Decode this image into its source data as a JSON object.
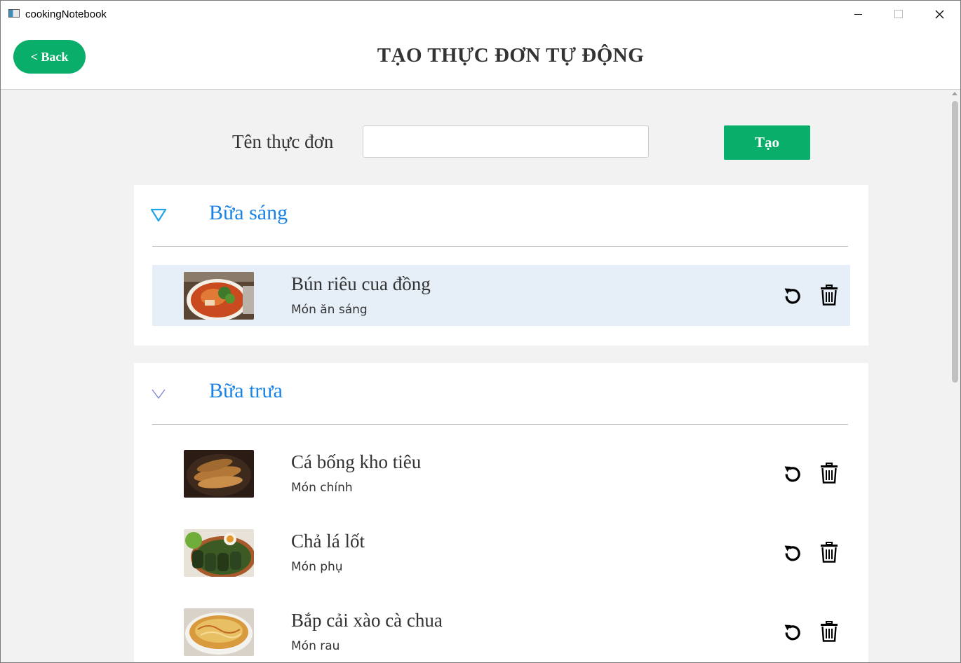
{
  "window": {
    "title": "cookingNotebook",
    "minimize_glyph": "—",
    "close_glyph": "✕"
  },
  "header": {
    "back_label": "< Back",
    "page_title": "TẠO THỰC ĐƠN TỰ ĐỘNG"
  },
  "form": {
    "name_label": "Tên thực đơn",
    "name_value": "",
    "create_label": "Tạo"
  },
  "colors": {
    "accent_green": "#0aae6b",
    "meal_title_blue": "#1a84e6",
    "selected_row": "#e6eef8"
  },
  "meals": [
    {
      "title": "Bữa sáng",
      "expanded": true,
      "dishes": [
        {
          "name": "Bún riêu cua đồng",
          "type": "Món ăn sáng",
          "icon": "bun-rieu-photo"
        }
      ]
    },
    {
      "title": "Bữa trưa",
      "expanded": true,
      "dishes": [
        {
          "name": "Cá bống kho tiêu",
          "type": "Món chính",
          "icon": "ca-bong-photo"
        },
        {
          "name": "Chả lá lốt",
          "type": "Món phụ",
          "icon": "cha-la-lot-photo"
        },
        {
          "name": "Bắp cải xào cà chua",
          "type": "Món rau",
          "icon": "bap-cai-photo"
        }
      ]
    }
  ]
}
